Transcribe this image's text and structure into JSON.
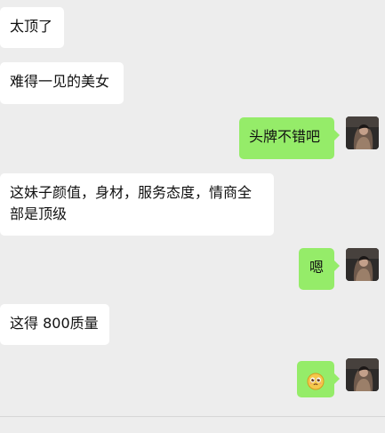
{
  "messages": {
    "m1": "太顶了",
    "m2": "难得一见的美女",
    "m3": "头牌不错吧",
    "m4": "这妹子颜值，身材，服务态度，情商全部是顶级",
    "m5": "嗯",
    "m6": "这得 800质量",
    "m7_emoji": "pleading-face-emoji"
  },
  "colors": {
    "background": "#ededed",
    "incoming_bubble": "#ffffff",
    "outgoing_bubble": "#95ec69",
    "text": "#111111"
  }
}
